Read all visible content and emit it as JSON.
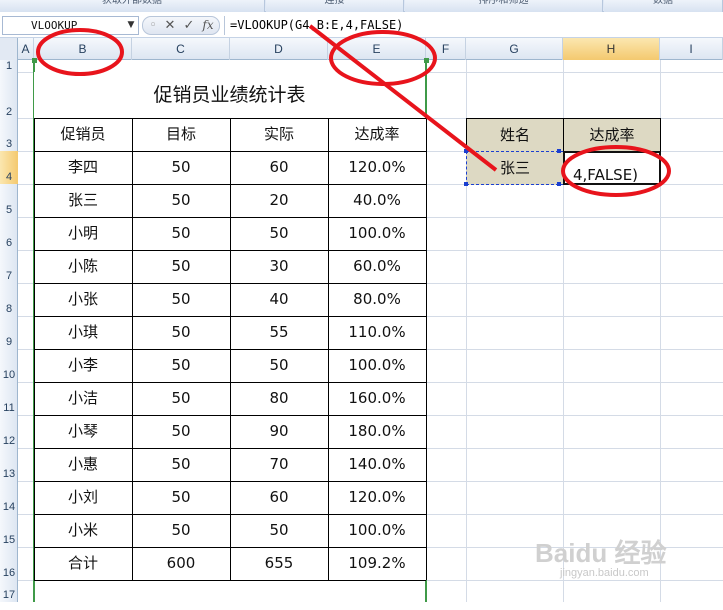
{
  "ribbon": {
    "groups": [
      "获取外部数据",
      "连接",
      "排序和筛选",
      "数据"
    ]
  },
  "formula_bar": {
    "name_box": "VLOOKUP",
    "cancel_glyph": "✕",
    "enter_glyph": "✓",
    "fx_glyph": "fx",
    "formula": "=VLOOKUP(G4,B:E,4,FALSE)"
  },
  "columns": [
    "A",
    "B",
    "C",
    "D",
    "E",
    "F",
    "G",
    "H",
    "I"
  ],
  "selected_column": "H",
  "rows": [
    "1",
    "2",
    "3",
    "4",
    "5",
    "6",
    "7",
    "8",
    "9",
    "10",
    "11",
    "12",
    "13",
    "14",
    "15",
    "16",
    "17"
  ],
  "selected_row": "4",
  "sheet_table": {
    "title": "促销员业绩统计表",
    "headers": [
      "促销员",
      "目标",
      "实际",
      "达成率"
    ],
    "rows": [
      [
        "李四",
        "50",
        "60",
        "120.0%"
      ],
      [
        "张三",
        "50",
        "20",
        "40.0%"
      ],
      [
        "小明",
        "50",
        "50",
        "100.0%"
      ],
      [
        "小陈",
        "50",
        "30",
        "60.0%"
      ],
      [
        "小张",
        "50",
        "40",
        "80.0%"
      ],
      [
        "小琪",
        "50",
        "55",
        "110.0%"
      ],
      [
        "小李",
        "50",
        "50",
        "100.0%"
      ],
      [
        "小洁",
        "50",
        "80",
        "160.0%"
      ],
      [
        "小琴",
        "50",
        "90",
        "180.0%"
      ],
      [
        "小惠",
        "50",
        "70",
        "140.0%"
      ],
      [
        "小刘",
        "50",
        "60",
        "120.0%"
      ],
      [
        "小米",
        "50",
        "50",
        "100.0%"
      ],
      [
        "合计",
        "600",
        "655",
        "109.2%"
      ]
    ]
  },
  "lookup_table": {
    "header_name": "姓名",
    "header_rate": "达成率",
    "name_value": "张三",
    "rate_editing": "4,FALSE)"
  },
  "annotation_color": "#e8141c",
  "watermark": {
    "logo": "Baidu 经验",
    "url": "jingyan.baidu.com"
  }
}
